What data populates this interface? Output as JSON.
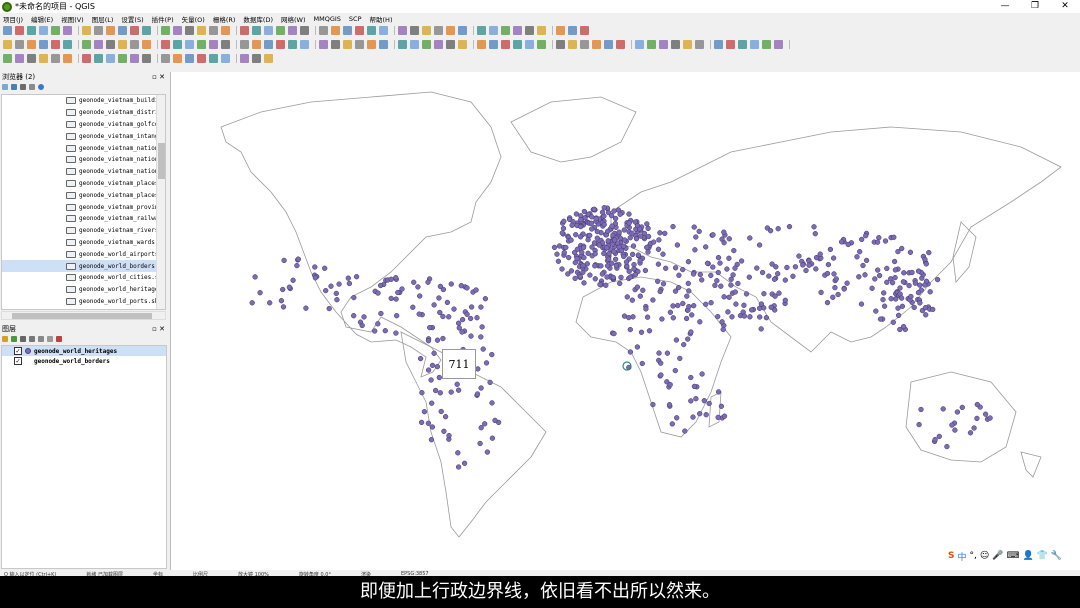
{
  "window": {
    "title": "*未命名的项目 - QGIS",
    "controls": [
      "—",
      "❐",
      "✕"
    ]
  },
  "menu": [
    "项目(J)",
    "编辑(E)",
    "视图(V)",
    "图层(L)",
    "设置(S)",
    "插件(P)",
    "矢量(O)",
    "栅格(R)",
    "数据库(D)",
    "网络(W)",
    "MMQGIS",
    "SCP",
    "帮助(H)"
  ],
  "browser": {
    "title": "浏览器 (2)",
    "items": [
      "geonode_vietnam_buildin",
      "geonode_vietnam_distric",
      "geonode_vietnam_golfcou",
      "geonode_vietnam_intangi",
      "geonode_vietnam_nationa",
      "geonode_vietnam_nationa",
      "geonode_vietnam_nationa",
      "geonode_vietnam_places",
      "geonode_vietnam_places",
      "geonode_vietnam_provinc",
      "geonode_vietnam_railway",
      "geonode_vietnam_rivers_",
      "geonode_vietnam_wards.s",
      "geonode_world_airports.",
      "geonode_world_borders.s",
      "geonode_world_cities.sh",
      "geonode_world_heritages",
      "geonode_world_ports.shp"
    ],
    "selected_index": 14
  },
  "layers": {
    "title": "图层",
    "items": [
      {
        "name": "geonode_world_heritages",
        "checked": true,
        "selected": true
      },
      {
        "name": "geonode_world_borders",
        "checked": true,
        "selected": false
      }
    ]
  },
  "map": {
    "tooltip": "711",
    "point_color": "#7d6cb2",
    "point_stroke": "#3d3270",
    "border_color": "#9a9a9a"
  },
  "ime": {
    "items": [
      "S",
      "中",
      "°,",
      "☺",
      "🎤",
      "⌨",
      "👤",
      "👕",
      "🔧"
    ]
  },
  "statusbar": {
    "text": [
      "Q 输入以定位 (Ctrl+K)",
      "就绪 已加载图层",
      "坐标",
      "比例尺",
      "放大镜 100%",
      "旋转角度 0.0°",
      "渲染",
      "EPSG:3857"
    ]
  },
  "subtitle": "即便加上行政边界线，依旧看不出所以然来。"
}
